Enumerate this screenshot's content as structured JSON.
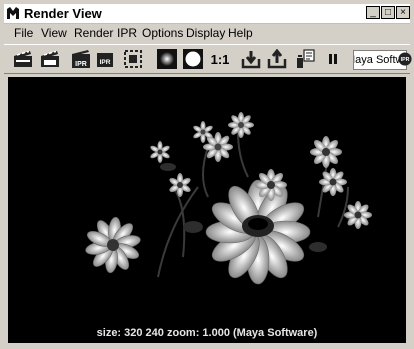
{
  "window": {
    "title": "Render View"
  },
  "menu": [
    "File",
    "View",
    "Render",
    "IPR",
    "Options",
    "Display",
    "Help"
  ],
  "toolbar": {
    "ratio_label": "1:1",
    "renderer": "Maya Software",
    "ipr_badge": "IPR"
  },
  "status": {
    "text": "size:  320  240 zoom: 1.000  (Maya Software)"
  },
  "winbuttons": {
    "minimize": "_",
    "restore": "□",
    "close": "×"
  },
  "toolbar_icons": [
    "render-clapper-icon",
    "redo-render-clapper-icon",
    "ipr-render-icon",
    "ipr-refresh-icon",
    "render-region-icon",
    "display-rgb-icon",
    "display-alpha-icon",
    "real-size-icon",
    "keep-image-icon",
    "remove-image-icon",
    "render-settings-icon",
    "pause-ipr-icon",
    "ipr-badge-icon"
  ]
}
